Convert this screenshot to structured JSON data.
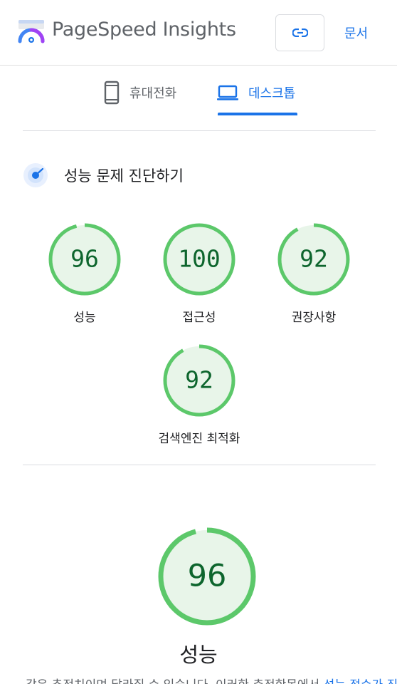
{
  "header": {
    "app_title": "PageSpeed Insights",
    "docs_label": "문서",
    "link_icon": "link-icon",
    "logo_icon": "pagespeed-logo-icon"
  },
  "tabs": [
    {
      "label": "휴대전화",
      "icon": "phone-icon",
      "selected": false
    },
    {
      "label": "데스크톱",
      "icon": "laptop-icon",
      "selected": true
    }
  ],
  "diagnosis": {
    "title": "성능 문제 진단하기",
    "icon": "diagnose-icon"
  },
  "scores": [
    {
      "label": "성능",
      "score": "96",
      "fraction": 0.96
    },
    {
      "label": "접근성",
      "score": "100",
      "fraction": 1.0
    },
    {
      "label": "권장사항",
      "score": "92",
      "fraction": 0.92
    },
    {
      "label": "검색엔진 최적화",
      "score": "92",
      "fraction": 0.92
    }
  ],
  "performance": {
    "score": "96",
    "fraction": 0.96,
    "title": "성능",
    "description_prefix": "값은 추정치이며 달라질 수 있습니다. 이러한 측정항목에서 ",
    "description_link": "성능 점수가 직접"
  },
  "colors": {
    "accent": "#1a73e8",
    "pass_ring": "#0cce6b",
    "pass_fill": "#e8f5e9",
    "pass_text": "#0d652d",
    "divider": "#dadce0"
  }
}
